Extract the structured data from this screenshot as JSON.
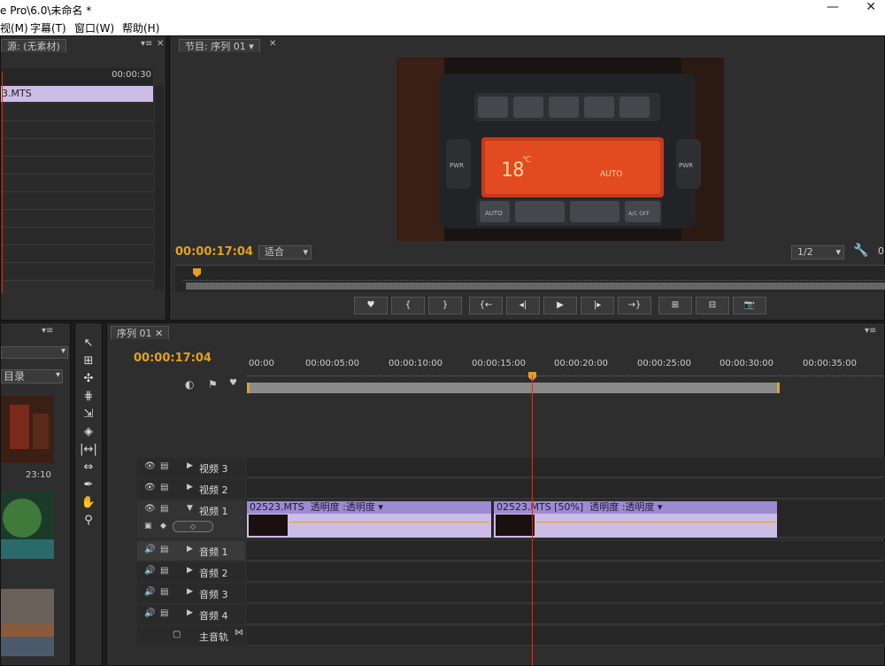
{
  "window": {
    "title": "e Pro\\6.0\\未命名 *",
    "minimize": "—",
    "close": "✕"
  },
  "menu": [
    "视(M)",
    "字幕(T)",
    "窗口(W)",
    "帮助(H)"
  ],
  "source_panel": {
    "tab": "源: (无素材)",
    "timecode": "00:00:30",
    "clip": "3.MTS"
  },
  "program_panel": {
    "tab": "节目: 序列 01",
    "timecode": "00:00:17:04",
    "fit": "适合",
    "ratio": "1/2",
    "ratio_extra": "0",
    "video_display": {
      "temperature": "18",
      "unit": "℃",
      "mode": "AUTO",
      "btn_auto": "AUTO",
      "btn_acoff": "A/C OFF",
      "pwr_left": "PWR",
      "pwr_right": "PWR"
    }
  },
  "transport": [
    "♥",
    "{",
    "}",
    "{←",
    "◂|",
    "▶",
    "|▸",
    "→}",
    "⊞",
    "⊟",
    "📷"
  ],
  "project_panel": {
    "folder": "目录",
    "duration": "23:10"
  },
  "timeline": {
    "tab": "序列 01",
    "timecode": "00:00:17:04",
    "ruler": [
      "00:00",
      "00:00:05:00",
      "00:00:10:00",
      "00:00:15:00",
      "00:00:20:00",
      "00:00:25:00",
      "00:00:30:00",
      "00:00:35:00"
    ],
    "tracks": {
      "video3": "视频 3",
      "video2": "视频 2",
      "video1": "视频 1",
      "audio1": "音频 1",
      "audio2": "音频 2",
      "audio3": "音频 3",
      "audio4": "音频 4",
      "master": "主音轨"
    },
    "clips": [
      {
        "name": "02523.MTS",
        "effect": "透明度 :透明度 ▾"
      },
      {
        "name": "02523.MTS [50%]",
        "effect": "透明度 :透明度 ▾"
      }
    ]
  },
  "colors": {
    "accent": "#e3a11e",
    "clip": "#cbbde6",
    "playline": "#c0392b"
  }
}
